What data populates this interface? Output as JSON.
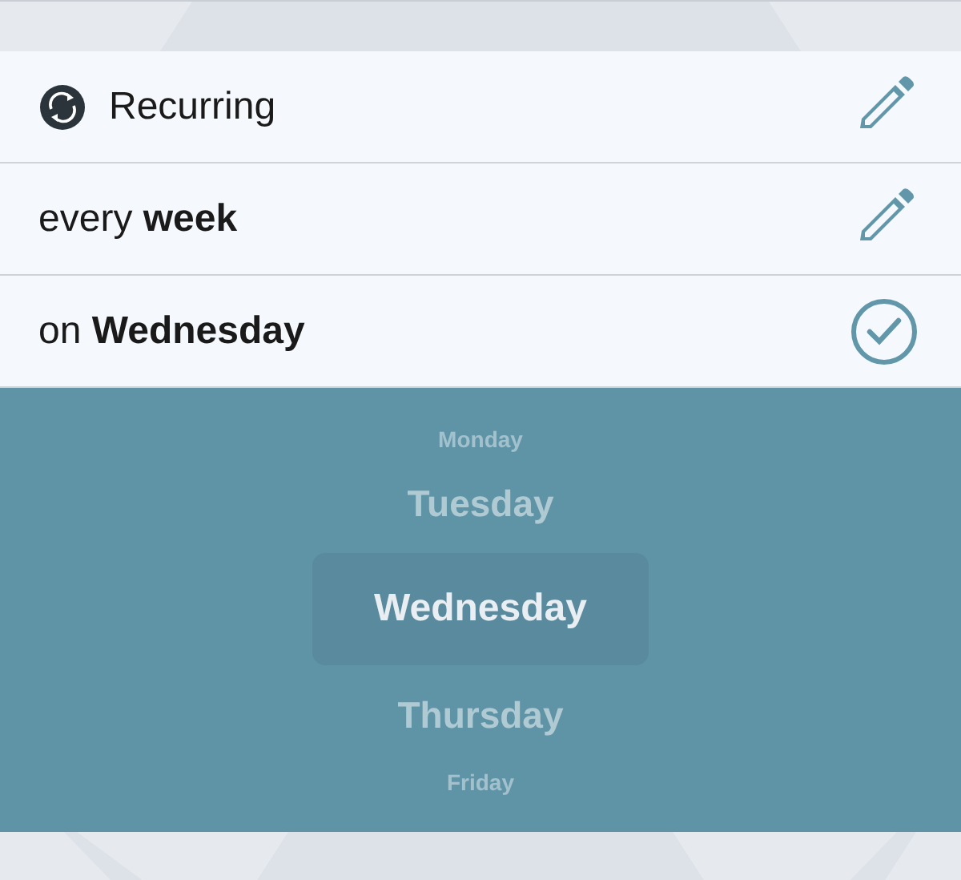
{
  "rows": [
    {
      "kind": "title",
      "text": "Recurring",
      "button": {
        "kind": "edit"
      }
    },
    {
      "kind": "setting",
      "text": "every **week**",
      "button": {
        "kind": "edit"
      }
    },
    {
      "kind": "setting",
      "text": "on **Wednesday**",
      "button": {
        "kind": "done"
      }
    }
  ],
  "picker": {
    "items": [
      {
        "label": "Monday",
        "selected": false
      },
      {
        "label": "Tuesday",
        "selected": false
      },
      {
        "label": "Wednesday",
        "selected": true
      },
      {
        "label": "Thursday",
        "selected": false
      },
      {
        "label": "Friday",
        "selected": false
      }
    ]
  }
}
